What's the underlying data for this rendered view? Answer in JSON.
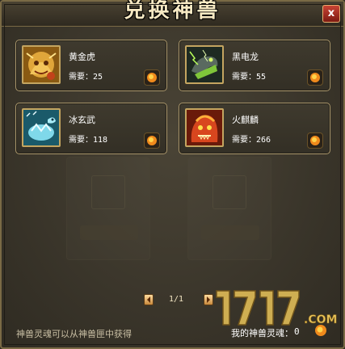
{
  "window": {
    "title": "兑换神兽",
    "close_label": "x"
  },
  "beasts": [
    {
      "name": "黄金虎",
      "cost_label": "需要：",
      "cost": "25",
      "portrait": "golden-tiger",
      "color": "#d9a23a"
    },
    {
      "name": "黑电龙",
      "cost_label": "需要：",
      "cost": "55",
      "portrait": "black-lightning-dragon",
      "color": "#7fc63a"
    },
    {
      "name": "冰玄武",
      "cost_label": "需要：",
      "cost": "118",
      "portrait": "ice-black-tortoise",
      "color": "#6fd4e6"
    },
    {
      "name": "火麒麟",
      "cost_label": "需要：",
      "cost": "266",
      "portrait": "fire-qilin",
      "color": "#e0502a"
    }
  ],
  "pager": {
    "current": "1/1",
    "prev_icon": "arrow-left-icon",
    "next_icon": "arrow-right-icon"
  },
  "footer": {
    "hint": "神兽灵魂可以从神兽匣中获得",
    "soul_label": "我的神兽灵魂：",
    "soul_value": "0",
    "soul_icon": "soul-orb-icon"
  },
  "watermark": {
    "text": "17173",
    "domain": ".COM"
  },
  "colors": {
    "frame_gold": "#a8956a",
    "panel_bg": "#3b362b",
    "orb_orange": "#f08a1c"
  }
}
